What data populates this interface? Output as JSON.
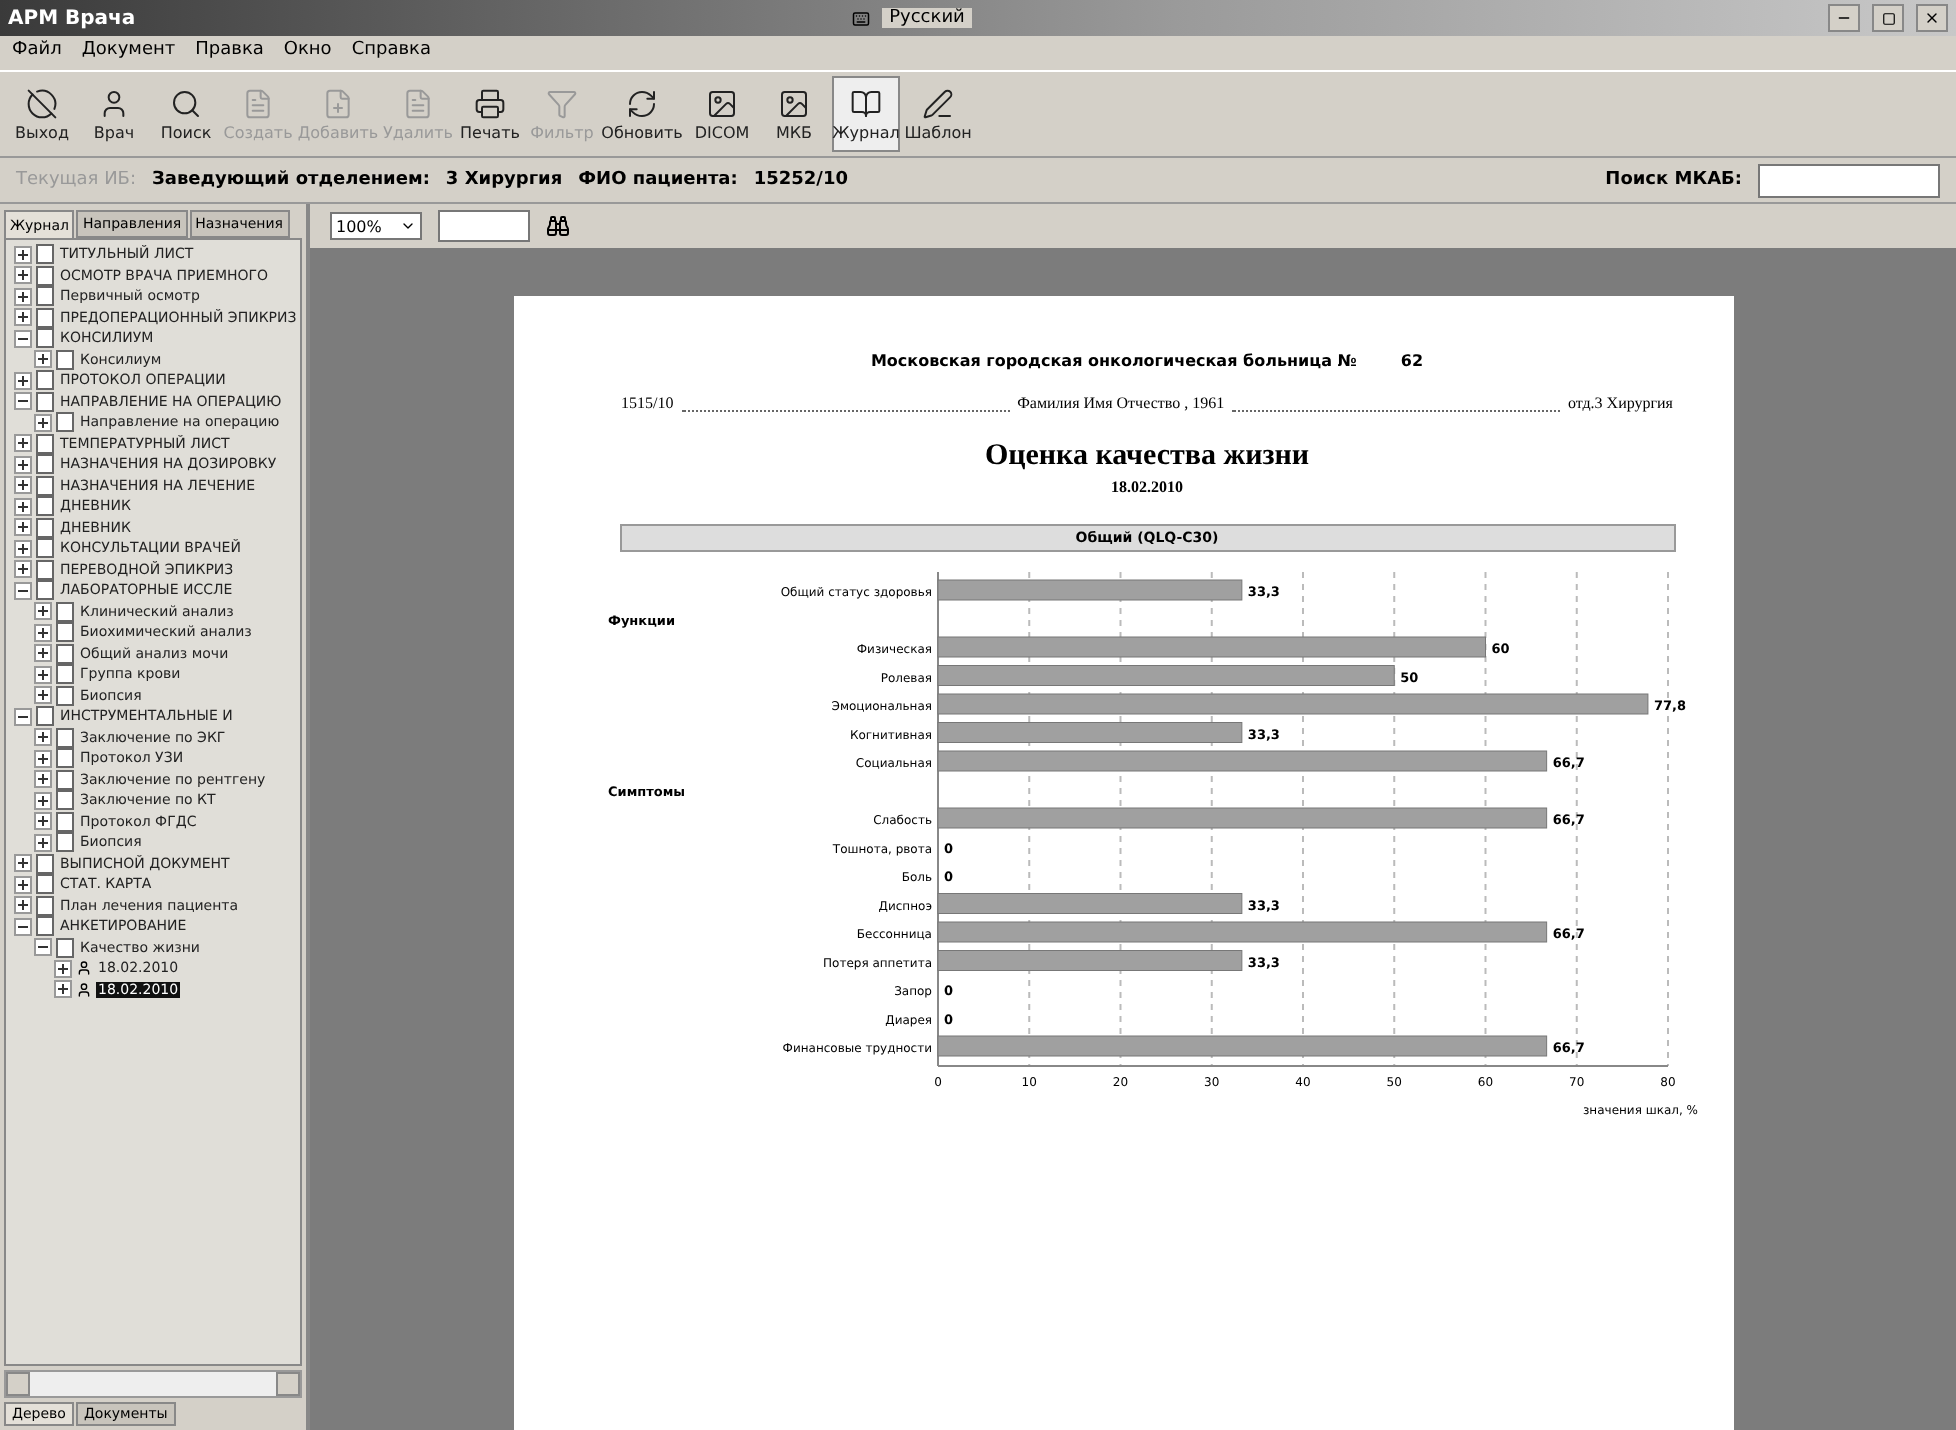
{
  "window": {
    "title": "АРМ Врача",
    "language": "Русский"
  },
  "menu": [
    "Файл",
    "Документ",
    "Правка",
    "Окно",
    "Справка"
  ],
  "toolbar": [
    {
      "label": "Выход",
      "disabled": false,
      "pressed": false
    },
    {
      "label": "Врач",
      "disabled": false,
      "pressed": false
    },
    {
      "label": "Поиск",
      "disabled": false,
      "pressed": false
    },
    {
      "label": "Создать",
      "disabled": true,
      "pressed": false
    },
    {
      "label": "Добавить",
      "disabled": true,
      "pressed": false
    },
    {
      "label": "Удалить",
      "disabled": true,
      "pressed": false
    },
    {
      "label": "Печать",
      "disabled": false,
      "pressed": false
    },
    {
      "label": "Фильтр",
      "disabled": true,
      "pressed": false
    },
    {
      "label": "Обновить",
      "disabled": false,
      "pressed": false
    },
    {
      "label": "DICOM",
      "disabled": false,
      "pressed": false
    },
    {
      "label": "МКБ",
      "disabled": false,
      "pressed": false
    },
    {
      "label": "Журнал",
      "disabled": false,
      "pressed": true
    },
    {
      "label": "Шаблон",
      "disabled": false,
      "pressed": false
    }
  ],
  "info_bar": {
    "hint": "Текущая ИБ:",
    "department_label": "Заведующий отделением:",
    "department": "3 Хирургия",
    "patient_label": "ФИО пациента:",
    "patient": "15252/10",
    "search_label": "Поиск МКАБ:"
  },
  "sidebar": {
    "tabs": [
      {
        "label": "Журнал",
        "selected": true
      },
      {
        "label": "Направления",
        "selected": false
      },
      {
        "label": "Назначения",
        "selected": false
      }
    ],
    "tree": [
      {
        "label": "ТИТУЛЬНЫЙ ЛИСТ",
        "expanded": false,
        "selected": false
      },
      {
        "label": "ОСМОТР ВРАЧА ПРИЕМНОГО",
        "expanded": false,
        "selected": false
      },
      {
        "label": "Первичный осмотр",
        "expanded": false,
        "selected": false
      },
      {
        "label": "ПРЕДОПЕРАЦИОННЫЙ ЭПИКРИЗ",
        "expanded": false,
        "selected": false
      },
      {
        "label": "КОНСИЛИУМ",
        "expanded": true,
        "selected": false,
        "children": [
          {
            "label": "Консилиум",
            "expanded": false,
            "selected": false
          }
        ]
      },
      {
        "label": "ПРОТОКОЛ ОПЕРАЦИИ",
        "expanded": false,
        "selected": false
      },
      {
        "label": "НАПРАВЛЕНИЕ НА ОПЕРАЦИЮ",
        "expanded": true,
        "selected": false,
        "children": [
          {
            "label": "Направление на операцию",
            "expanded": false,
            "selected": false
          }
        ]
      },
      {
        "label": "ТЕМПЕРАТУРНЫЙ ЛИСТ",
        "expanded": false,
        "selected": false
      },
      {
        "label": "НАЗНАЧЕНИЯ НА ДОЗИРОВКУ",
        "expanded": false,
        "selected": false
      },
      {
        "label": "НАЗНАЧЕНИЯ НА ЛЕЧЕНИЕ",
        "expanded": false,
        "selected": false
      },
      {
        "label": "ДНЕВНИК",
        "expanded": false,
        "selected": false
      },
      {
        "label": "ДНЕВНИК",
        "expanded": false,
        "selected": false
      },
      {
        "label": "КОНСУЛЬТАЦИИ ВРАЧЕЙ",
        "expanded": false,
        "selected": false
      },
      {
        "label": "ПЕРЕВОДНОЙ ЭПИКРИЗ",
        "expanded": false,
        "selected": false
      },
      {
        "label": "ЛАБОРАТОРНЫЕ ИССЛЕ",
        "expanded": true,
        "selected": false,
        "children": [
          {
            "label": "Клинический анализ",
            "expanded": false,
            "selected": false
          },
          {
            "label": "Биохимический анализ",
            "expanded": false,
            "selected": false
          },
          {
            "label": "Общий анализ мочи",
            "expanded": false,
            "selected": false
          },
          {
            "label": "Группа крови",
            "expanded": false,
            "selected": false
          },
          {
            "label": "Биопсия",
            "expanded": false,
            "selected": false
          }
        ]
      },
      {
        "label": "ИНСТРУМЕНТАЛЬНЫЕ И",
        "expanded": true,
        "selected": false,
        "children": [
          {
            "label": "Заключение по ЭКГ",
            "expanded": false,
            "selected": false
          },
          {
            "label": "Протокол УЗИ",
            "expanded": false,
            "selected": false
          },
          {
            "label": "Заключение по рентгену",
            "expanded": false,
            "selected": false
          },
          {
            "label": "Заключение по КТ",
            "expanded": false,
            "selected": false
          },
          {
            "label": "Протокол ФГДС",
            "expanded": false,
            "selected": false
          },
          {
            "label": "Биопсия",
            "expanded": false,
            "selected": false
          }
        ]
      },
      {
        "label": "ВЫПИСНОЙ ДОКУМЕНТ",
        "expanded": false,
        "selected": false
      },
      {
        "label": "СТАТ. КАРТА",
        "expanded": false,
        "selected": false
      },
      {
        "label": "План лечения пациента",
        "expanded": false,
        "selected": false
      },
      {
        "label": "АНКЕТИРОВАНИЕ",
        "expanded": true,
        "selected": false,
        "children": [
          {
            "label": "Качество жизни",
            "expanded": true,
            "selected": false,
            "children": [
              {
                "label": "18.02.2010",
                "expanded": false,
                "selected": false,
                "kind": "record"
              },
              {
                "label": "18.02.2010",
                "expanded": false,
                "selected": true,
                "kind": "record"
              }
            ]
          }
        ]
      }
    ],
    "bottom_tabs": [
      {
        "label": "Дерево",
        "selected": true
      },
      {
        "label": "Документы",
        "selected": false
      }
    ]
  },
  "viewer_toolbar": {
    "zoom": "100%"
  },
  "document": {
    "hospital": "Московская городская онкологическая больница №",
    "hospital_number": "62",
    "case_number": "1515/10",
    "patient": "Фамилия Имя Отчество , 1961",
    "department": "отд.3 Хирургия",
    "title": "Оценка качества жизни",
    "date": "18.02.2010",
    "section": "Общий (QLQ-C30)",
    "chart_data": {
      "type": "bar",
      "orientation": "horizontal",
      "xlabel": "значения шкал, %",
      "categories": [
        "Общий статус здоровья",
        "Физическая",
        "Ролевая",
        "Эмоциональная",
        "Когнитивная",
        "Социальная",
        "Слабость",
        "Тошнота, рвота",
        "Боль",
        "Диспноэ",
        "Бессонница",
        "Потеря аппетита",
        "Запор",
        "Диарея",
        "Финансовые трудности"
      ],
      "series": [
        {
          "color": "#a0a0a0",
          "values": [
            33.3,
            60,
            50,
            77.8,
            33.3,
            66.7,
            66.7,
            0,
            0,
            33.3,
            66.7,
            33.3,
            0,
            0,
            66.7
          ]
        }
      ],
      "value_labels": [
        "33,3",
        "60",
        "50",
        "77,8",
        "33,3",
        "66,7",
        "66,7",
        "0",
        "0",
        "33,3",
        "66,7",
        "33,3",
        "0",
        "0",
        "66,7"
      ],
      "annotations": [
        "Функции",
        "Симптомы"
      ],
      "grid": true,
      "xlim": [
        0,
        80
      ],
      "xticks": [
        0,
        10,
        20,
        30,
        40,
        50,
        60,
        70,
        80
      ]
    }
  }
}
